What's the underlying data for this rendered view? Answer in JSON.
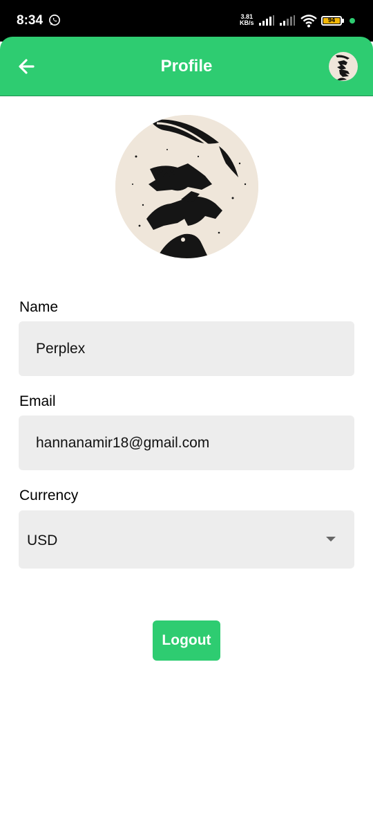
{
  "status_bar": {
    "time": "8:34",
    "net_speed_value": "3.81",
    "net_speed_unit": "KB/s",
    "battery_level": "94",
    "icons": [
      "whatsapp-icon",
      "signal-icon",
      "signal-icon",
      "wifi-icon",
      "battery-icon"
    ]
  },
  "app_bar": {
    "title": "Profile",
    "back_icon": "arrow-left-icon",
    "accent_color": "#2ecc71"
  },
  "profile": {
    "name_label": "Name",
    "name_value": "Perplex",
    "email_label": "Email",
    "email_value": "hannanamir18@gmail.com",
    "currency_label": "Currency",
    "currency_value": "USD"
  },
  "actions": {
    "logout_label": "Logout"
  }
}
